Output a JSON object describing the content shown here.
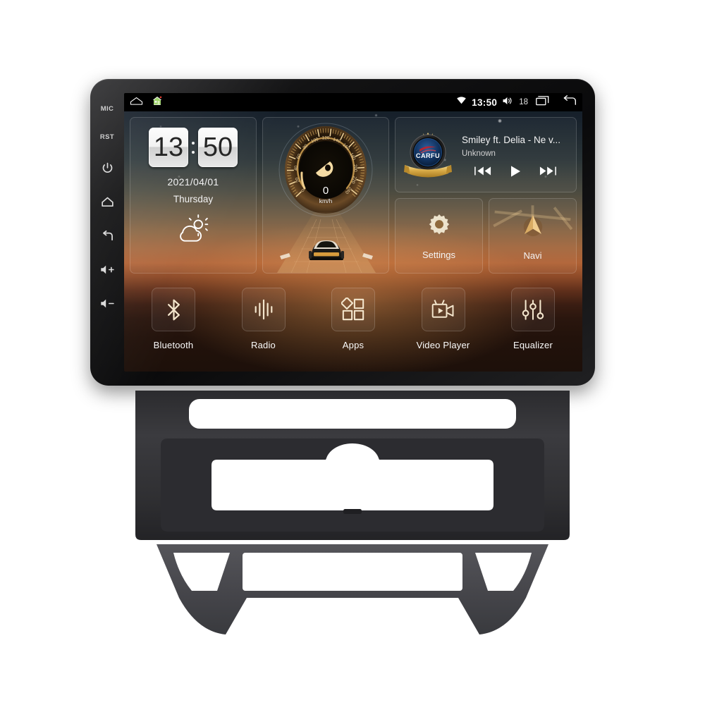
{
  "device": {
    "name": "Android Car Head Unit",
    "hardware_keys": [
      {
        "name": "mic",
        "label": "MIC"
      },
      {
        "name": "reset",
        "label": "RST"
      },
      {
        "name": "power",
        "label": ""
      },
      {
        "name": "home",
        "label": ""
      },
      {
        "name": "back",
        "label": ""
      },
      {
        "name": "volume-up",
        "label": "+"
      },
      {
        "name": "volume-down",
        "label": "-"
      }
    ]
  },
  "statusbar": {
    "left_icons": [
      "home-outline-icon",
      "house-app-icon"
    ],
    "wifi_icon": "wifi-icon",
    "time": "13:50",
    "volume_icon": "volume-icon",
    "volume_level": "18",
    "recents_icon": "recents-icon",
    "back_icon": "back-icon"
  },
  "clock_widget": {
    "hours": "13",
    "minutes": "50",
    "date": "2021/04/01",
    "weekday": "Thursday",
    "weather_icon": "sun-behind-cloud-icon"
  },
  "speedometer": {
    "value": "0",
    "unit": "km/h",
    "ticks": [
      "0",
      "20",
      "40",
      "60",
      "80",
      "100",
      "120",
      "140",
      "160",
      "180",
      "200",
      "220",
      "240"
    ],
    "min": 0,
    "max": 240,
    "needle_icon": "speed-pointer-icon",
    "road_icon": "car-on-road-icon"
  },
  "media_widget": {
    "album_art": "carfu-badge-logo",
    "album_art_text": "CARFU",
    "title": "Smiley ft. Delia - Ne v...",
    "artist": "Unknown",
    "controls": [
      {
        "name": "previous-track-button",
        "icon": "previous-icon"
      },
      {
        "name": "play-button",
        "icon": "play-icon"
      },
      {
        "name": "next-track-button",
        "icon": "next-icon"
      }
    ]
  },
  "shortcuts": [
    {
      "name": "settings",
      "label": "Settings",
      "icon": "gear-icon"
    },
    {
      "name": "navi",
      "label": "Navi",
      "icon": "navigation-arrow-icon"
    }
  ],
  "dock": [
    {
      "name": "bluetooth",
      "label": "Bluetooth",
      "icon": "bluetooth-icon"
    },
    {
      "name": "radio",
      "label": "Radio",
      "icon": "radio-waveform-icon"
    },
    {
      "name": "apps",
      "label": "Apps",
      "icon": "apps-grid-icon"
    },
    {
      "name": "video-player",
      "label": "Video Player",
      "icon": "video-camera-icon"
    },
    {
      "name": "equalizer",
      "label": "Equalizer",
      "icon": "equalizer-sliders-icon"
    }
  ],
  "colors": {
    "accent_gold": "#e8c98a",
    "bezel": "#121213",
    "sky": "#121a26",
    "sunset": "#b06235",
    "status_bar": "#000000",
    "fascia": "#4a4a4d"
  }
}
